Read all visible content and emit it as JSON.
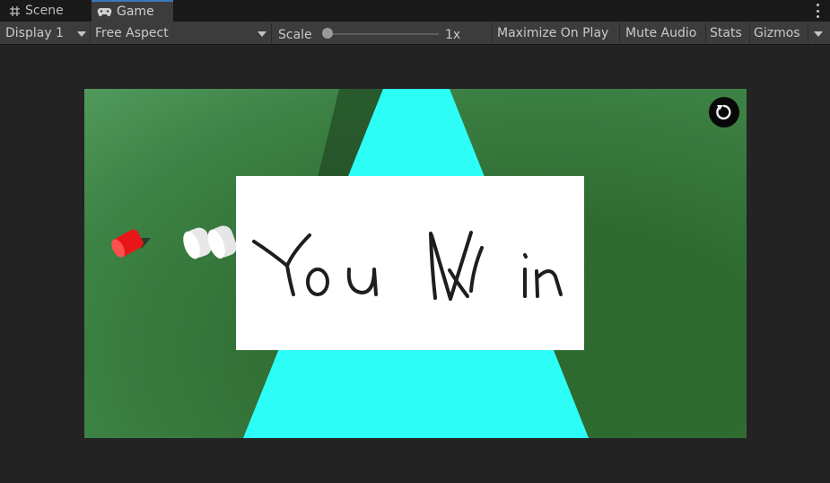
{
  "tabs": [
    {
      "label": "Scene",
      "icon": "grid-hash-icon"
    },
    {
      "label": "Game",
      "icon": "gamepad-icon"
    }
  ],
  "toolbar": {
    "display": "Display 1",
    "aspect": "Free Aspect",
    "scale_label": "Scale",
    "scale_value": "1x",
    "scale_level": 0,
    "maximize": "Maximize On Play",
    "mute": "Mute Audio",
    "stats": "Stats",
    "gizmos": "Gizmos"
  },
  "game": {
    "message": "You Win",
    "restart_icon": "restart-icon",
    "colors": {
      "ground": "#2f6b31",
      "road": "#2cfdf7",
      "player": "#ff2a2a",
      "dialog": "#ffffff",
      "ink": "#1e1e1e"
    }
  }
}
